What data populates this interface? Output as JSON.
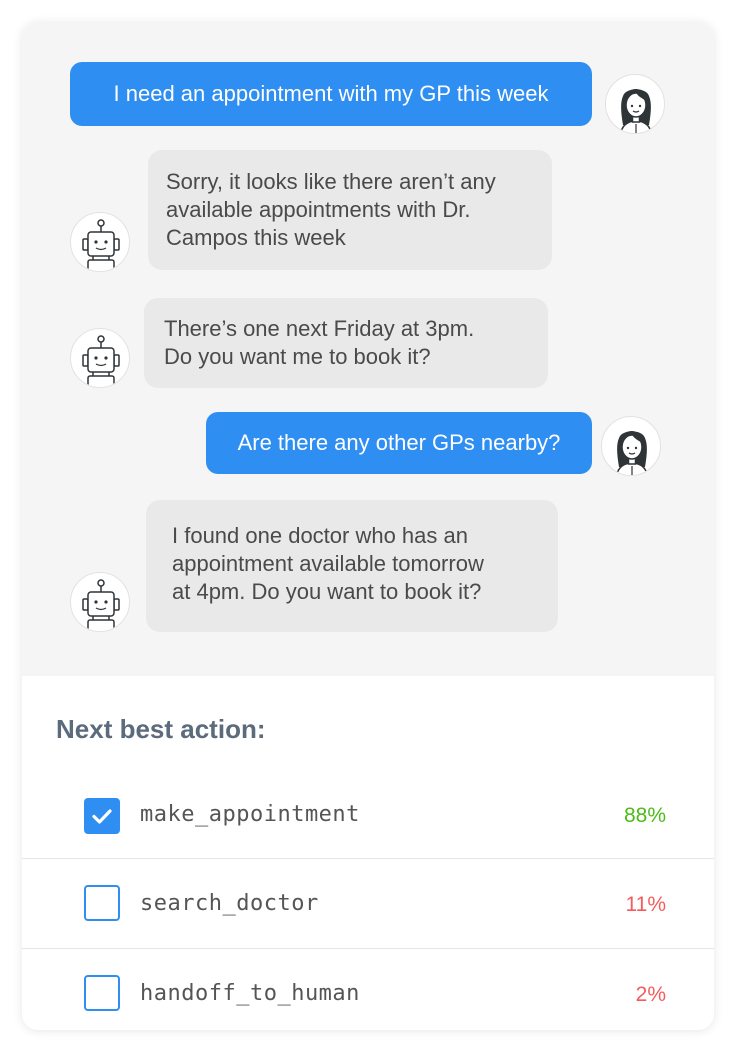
{
  "colors": {
    "user_bubble": "#2f8ef2",
    "bot_bubble": "#e9e9e9",
    "chat_background": "#f5f5f5",
    "high_confidence": "#4cbb17",
    "low_confidence": "#f25c5c",
    "checkbox": "#2f8ef2"
  },
  "messages": [
    {
      "sender": "user",
      "avatar_icon": "woman-avatar-icon",
      "text": "I need an appointment with my GP this week"
    },
    {
      "sender": "bot",
      "avatar_icon": "robot-avatar-icon",
      "text": "Sorry, it looks like there aren’t any\navailable appointments with Dr.\nCampos this week"
    },
    {
      "sender": "bot",
      "avatar_icon": "robot-avatar-icon",
      "text": "There’s one next Friday at 3pm.\nDo you want me to book it?"
    },
    {
      "sender": "user",
      "avatar_icon": "woman-avatar-icon",
      "text": "Are there any other GPs nearby?"
    },
    {
      "sender": "bot",
      "avatar_icon": "robot-avatar-icon",
      "text": "I found one doctor who has an\nappointment available tomorrow\nat 4pm. Do you want to book it?"
    }
  ],
  "next_best_action": {
    "title": "Next best action:",
    "actions": [
      {
        "name": "make_appointment",
        "confidence": "88%",
        "checked": true
      },
      {
        "name": "search_doctor",
        "confidence": "11%",
        "checked": false
      },
      {
        "name": "handoff_to_human",
        "confidence": "2%",
        "checked": false
      }
    ]
  }
}
